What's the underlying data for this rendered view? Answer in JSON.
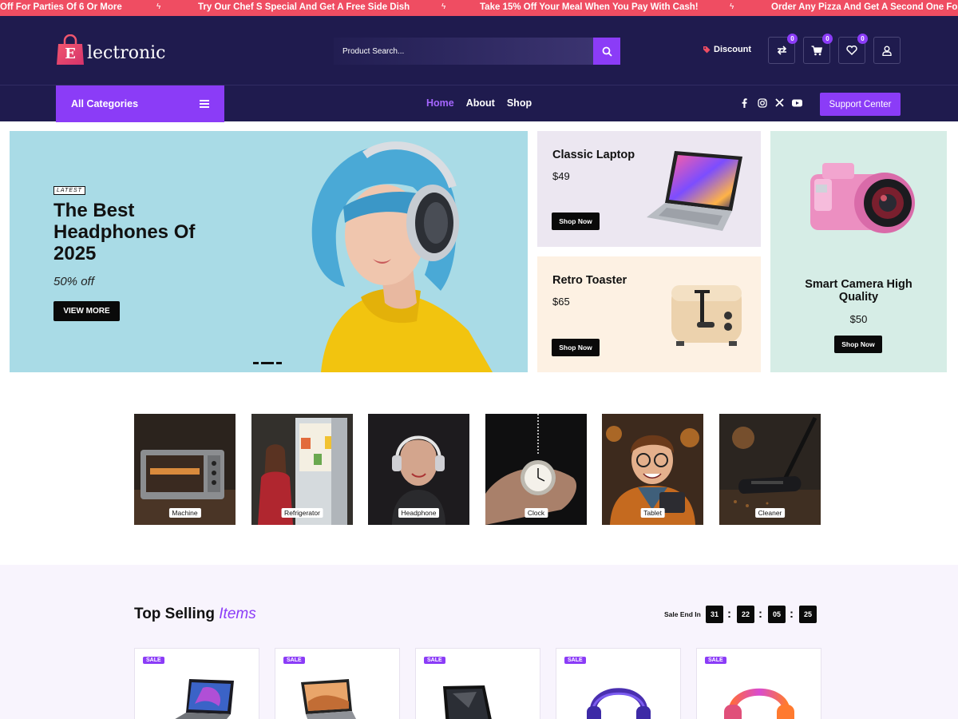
{
  "ticker": [
    "Off For Parties Of 6 Or More",
    "Try Our Chef S Special And Get A Free Side Dish",
    "Take 15% Off Your Meal When You Pay With Cash!",
    "Order Any Pizza And Get A Second One For"
  ],
  "header": {
    "logo_letter": "E",
    "logo_text": "lectronic",
    "search_placeholder": "Product Search...",
    "discount_label": "Discount",
    "compare_count": "0",
    "cart_count": "0",
    "wishlist_count": "0"
  },
  "nav": {
    "all_categories": "All Categories",
    "links": [
      "Home",
      "About",
      "Shop"
    ],
    "support": "Support Center"
  },
  "hero": {
    "tag": "LATEST",
    "title": "The Best Headphones Of 2025",
    "offer": "50% off",
    "button": "VIEW MORE"
  },
  "promos": [
    {
      "title": "Classic Laptop",
      "price": "$49",
      "button": "Shop Now"
    },
    {
      "title": "Retro Toaster",
      "price": "$65",
      "button": "Shop Now"
    },
    {
      "title": "Smart Camera High Quality",
      "price": "$50",
      "button": "Shop Now"
    }
  ],
  "categories": [
    "Machine",
    "Refrigerator",
    "Headphone",
    "Clock",
    "Tablet",
    "Cleaner"
  ],
  "top_selling": {
    "title": "Top Selling",
    "title_accent": "Items",
    "sale_end_label": "Sale End In",
    "timer": [
      "31",
      "22",
      "05",
      "25"
    ],
    "badge": "SALE"
  },
  "colors": {
    "brand_purple": "#8b3cf7",
    "header_navy": "#1f1b4e",
    "ticker_red": "#ef4d62"
  }
}
